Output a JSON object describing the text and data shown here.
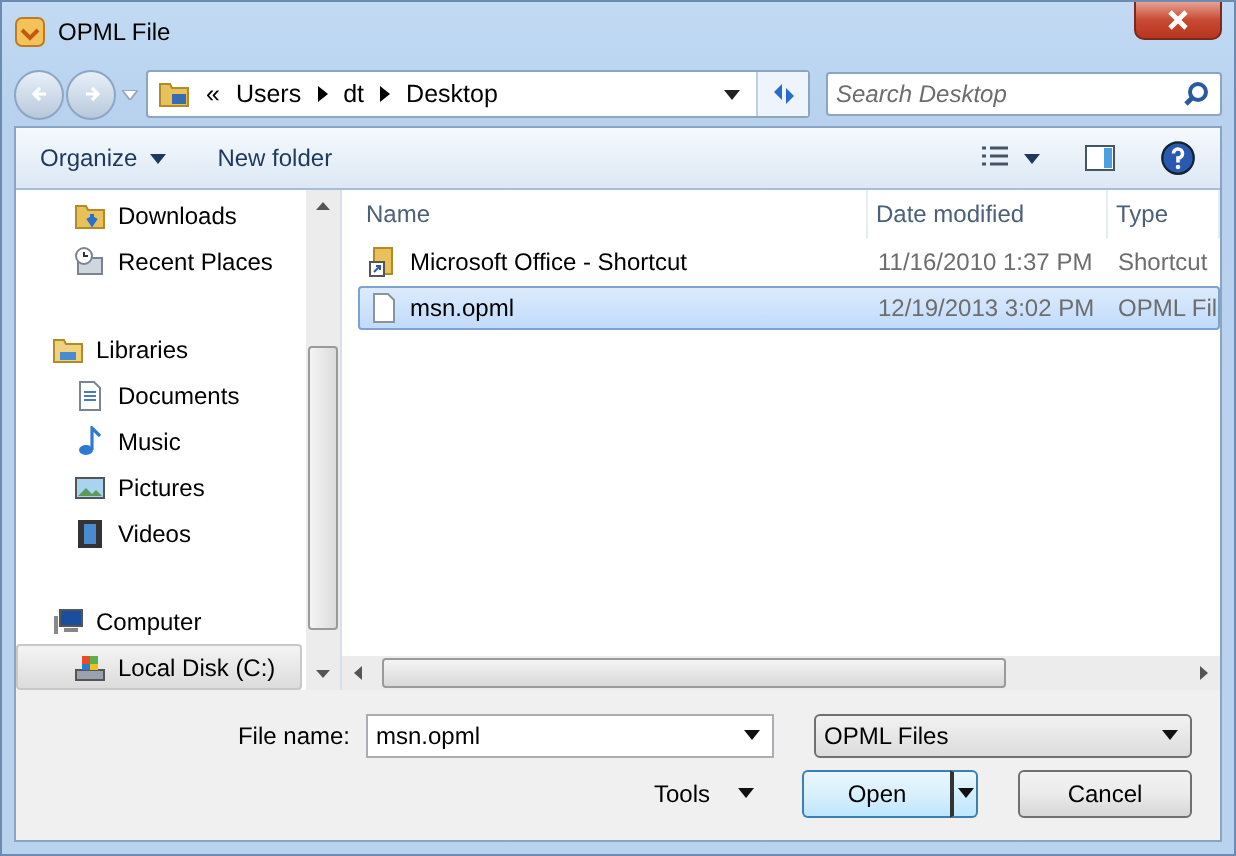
{
  "window": {
    "title": "OPML File"
  },
  "address": {
    "overflow": "«",
    "crumbs": [
      "Users",
      "dt",
      "Desktop"
    ]
  },
  "search": {
    "placeholder": "Search Desktop"
  },
  "toolbar": {
    "organize": "Organize",
    "new_folder": "New folder"
  },
  "sidebar": {
    "groups": [
      {
        "children": [
          {
            "label": "Downloads",
            "selected": false
          },
          {
            "label": "Recent Places",
            "selected": false
          }
        ]
      },
      {
        "label": "Libraries",
        "selected": false,
        "children": [
          {
            "label": "Documents",
            "selected": false
          },
          {
            "label": "Music",
            "selected": false
          },
          {
            "label": "Pictures",
            "selected": false
          },
          {
            "label": "Videos",
            "selected": false
          }
        ]
      },
      {
        "label": "Computer",
        "selected": false,
        "children": [
          {
            "label": "Local Disk (C:)",
            "selected": true
          }
        ]
      }
    ]
  },
  "table": {
    "columns": [
      "Name",
      "Date modified",
      "Type"
    ],
    "rows": [
      {
        "kind": "shortcut",
        "name": "Microsoft Office - Shortcut",
        "date": "11/16/2010 1:37 PM",
        "type": "Shortcut",
        "selected": false
      },
      {
        "kind": "file",
        "name": "msn.opml",
        "date": "12/19/2013 3:02 PM",
        "type": "OPML Fil",
        "selected": true
      }
    ]
  },
  "file_name": {
    "label": "File name:",
    "value": "msn.opml"
  },
  "file_type": {
    "value": "OPML Files"
  },
  "buttons": {
    "tools": "Tools",
    "open": "Open",
    "cancel": "Cancel"
  }
}
